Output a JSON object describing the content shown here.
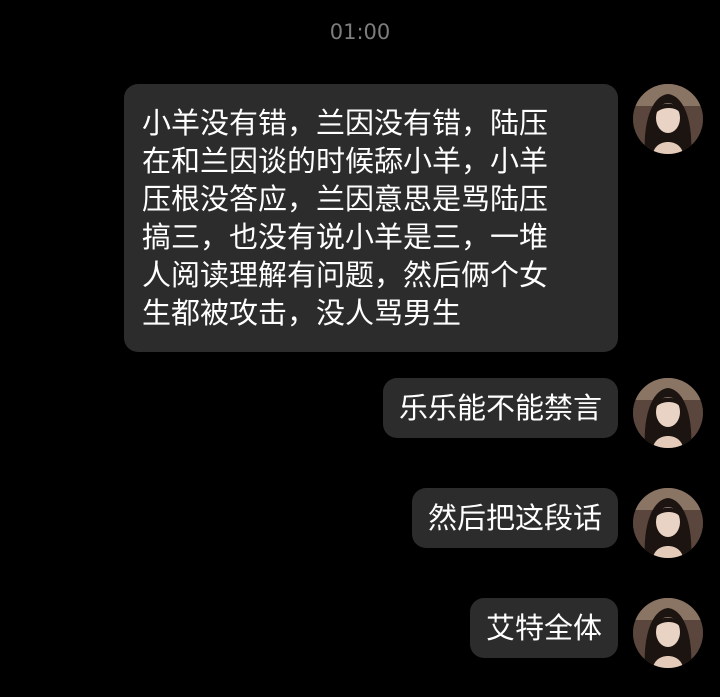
{
  "header": {
    "time": "01:00"
  },
  "messages": [
    {
      "text": "小羊没有错，兰因没有错，陆压\n在和兰因谈的时候舔小羊，小羊\n压根没答应，兰因意思是骂陆压\n搞三，也没有说小羊是三，一堆\n人阅读理解有问题，然后俩个女\n生都被攻击，没人骂男生",
      "sender": "self"
    },
    {
      "text": "乐乐能不能禁言",
      "sender": "self"
    },
    {
      "text": "然后把这段话",
      "sender": "self"
    },
    {
      "text": "艾特全体",
      "sender": "self"
    }
  ],
  "colors": {
    "background": "#000000",
    "bubble": "#2c2c2c",
    "text": "#ffffff",
    "timestamp": "#7d7d7d"
  },
  "avatar_icon": "user-avatar-photo-icon"
}
